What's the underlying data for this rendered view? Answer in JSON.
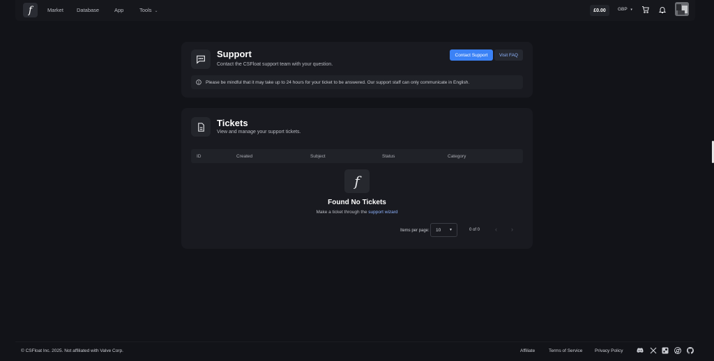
{
  "header": {
    "logo_glyph": "f",
    "nav": [
      "Market",
      "Database",
      "App",
      "Tools"
    ],
    "balance": "£0.00",
    "currency": "GBP",
    "icons": [
      "cart-icon",
      "bell-icon"
    ]
  },
  "support": {
    "title": "Support",
    "subtitle": "Contact the CSFloat support team with your question.",
    "contact_button": "Contact Support",
    "faq_button": "Visit FAQ",
    "notice": "Please be mindful that it may take up to 24 hours for your ticket to be answered. Our support staff can only communicate in English."
  },
  "tickets": {
    "title": "Tickets",
    "subtitle": "View and manage your support tickets.",
    "columns": [
      "ID",
      "Created",
      "Subject",
      "Status",
      "Category"
    ],
    "empty_glyph": "f",
    "empty_title": "Found No Tickets",
    "empty_text": "Make a ticket through the",
    "empty_link": "support wizard",
    "items_per_page_label": "Items per page:",
    "items_per_page_value": "10",
    "range": "0 of 0"
  },
  "footer": {
    "copyright": "© CSFloat Inc. 2025. Not affiliated with Valve Corp.",
    "links": [
      "Affiliate",
      "Terms of Service",
      "Privacy Policy"
    ],
    "social_icons": [
      "discord-icon",
      "x-icon",
      "steam-icon",
      "chrome-icon",
      "github-icon"
    ]
  },
  "colors": {
    "accent": "#3b82f6",
    "link": "#8fb4ff",
    "background": "#121318",
    "card": "#191a20"
  }
}
